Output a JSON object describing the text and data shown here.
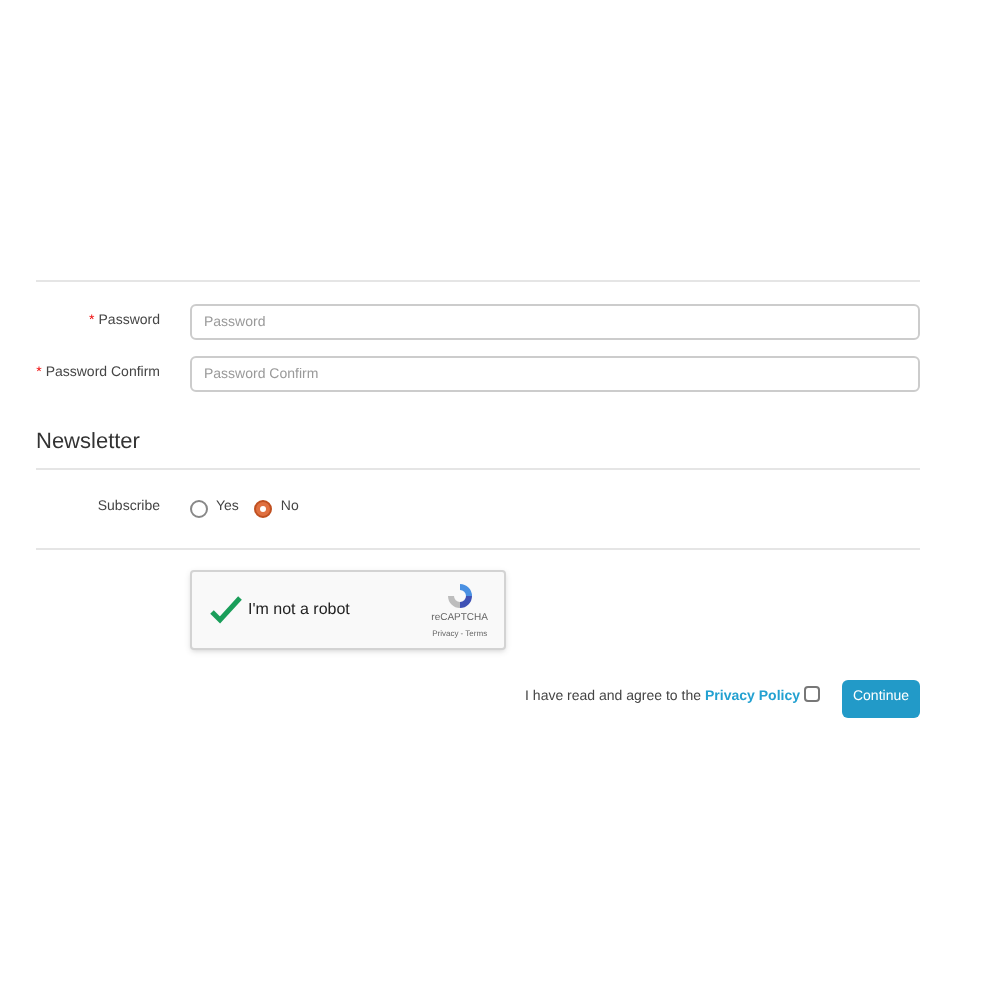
{
  "password_fields": [
    {
      "label": "Password",
      "required": true,
      "placeholder": "Password"
    },
    {
      "label": "Password Confirm",
      "required": true,
      "placeholder": "Password Confirm"
    }
  ],
  "required_mark": "*",
  "newsletter": {
    "heading": "Newsletter",
    "label": "Subscribe",
    "options": [
      {
        "label": "Yes",
        "selected": false
      },
      {
        "label": "No",
        "selected": true
      }
    ]
  },
  "captcha": {
    "label": "I'm not a robot",
    "checked": true,
    "brand": "reCAPTCHA",
    "links": "Privacy - Terms"
  },
  "agreement": {
    "text": "I have read and agree to the",
    "link": "Privacy Policy",
    "checked": false
  },
  "continue_button": "Continue"
}
